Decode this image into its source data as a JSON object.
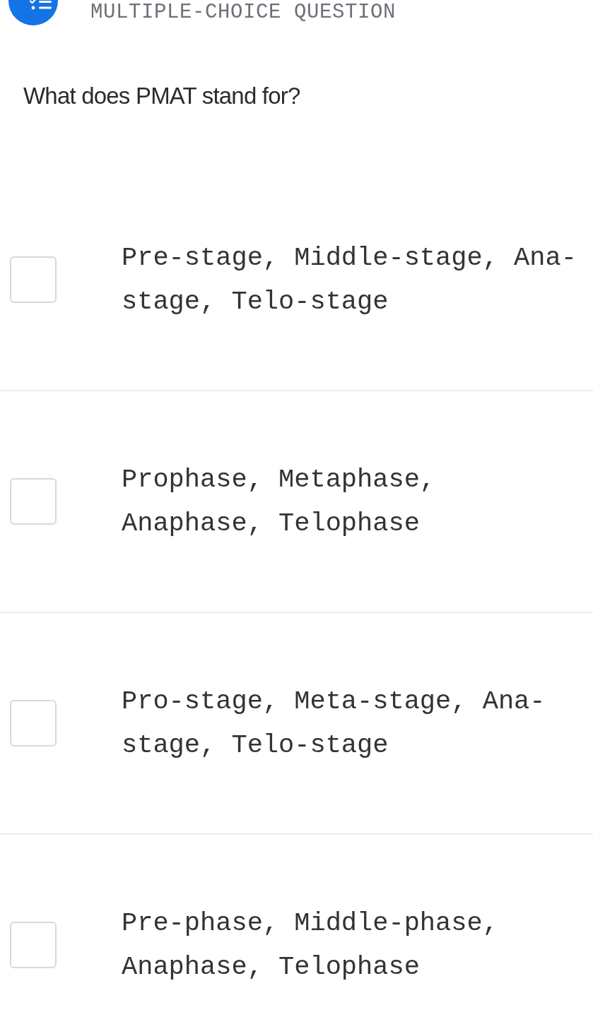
{
  "header": {
    "title": "MULTIPLE-CHOICE QUESTION"
  },
  "question": "What does PMAT stand for?",
  "options": [
    {
      "text": "Pre-stage, Middle-stage, Ana-stage, Telo-stage",
      "checked": false
    },
    {
      "text": "Prophase, Metaphase, Anaphase, Telophase",
      "checked": false
    },
    {
      "text": "Pro-stage, Meta-stage, Ana-stage, Telo-stage",
      "checked": false
    },
    {
      "text": "Pre-phase, Middle-phase, Anaphase, Telophase",
      "checked": false
    }
  ]
}
